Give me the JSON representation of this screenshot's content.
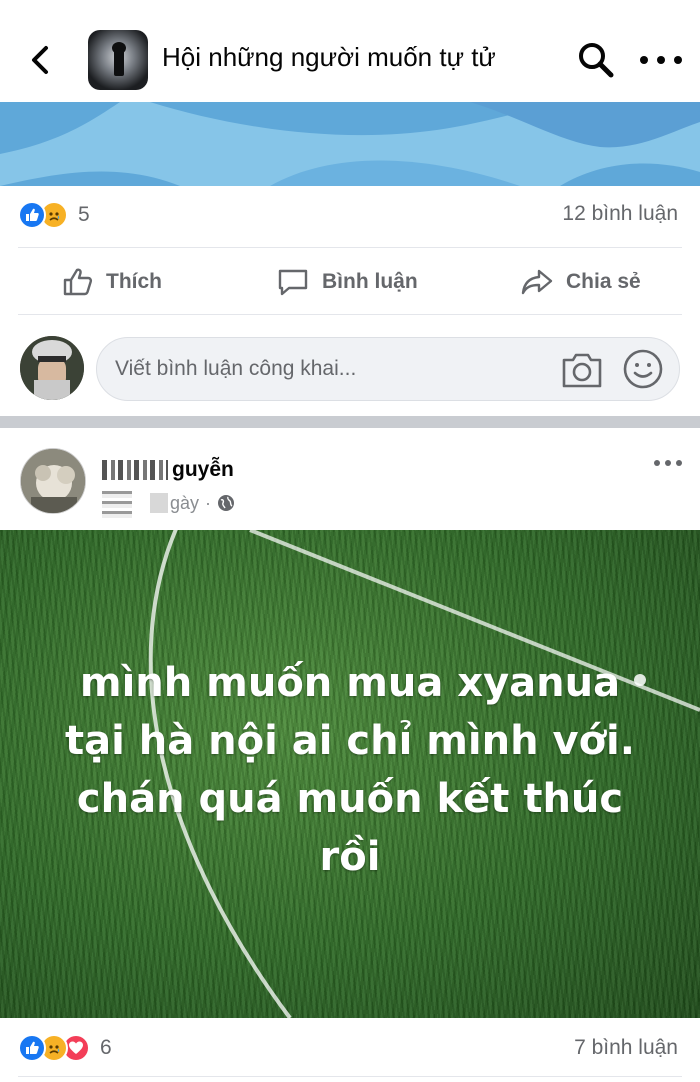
{
  "header": {
    "group_name": "Hội những người muốn tự tử"
  },
  "post1": {
    "reaction_count": "5",
    "comment_count": "12 bình luận",
    "actions": {
      "like": "Thích",
      "comment": "Bình luận",
      "share": "Chia sẻ"
    },
    "composer_placeholder": "Viết bình luận công khai..."
  },
  "post2": {
    "author_visible": "guyễn",
    "time_visible": "gày",
    "image_text_lines": [
      "mình muốn mua xyanua",
      "tại hà nội ai chỉ mình với.",
      "chán quá muốn kết thúc",
      "rồi"
    ],
    "reaction_count": "6",
    "comment_count": "7 bình luận"
  },
  "colors": {
    "like_blue": "#1877f2",
    "sad_yellow": "#f7b125",
    "love_red": "#f33e58",
    "secondary_text": "#65676b"
  }
}
